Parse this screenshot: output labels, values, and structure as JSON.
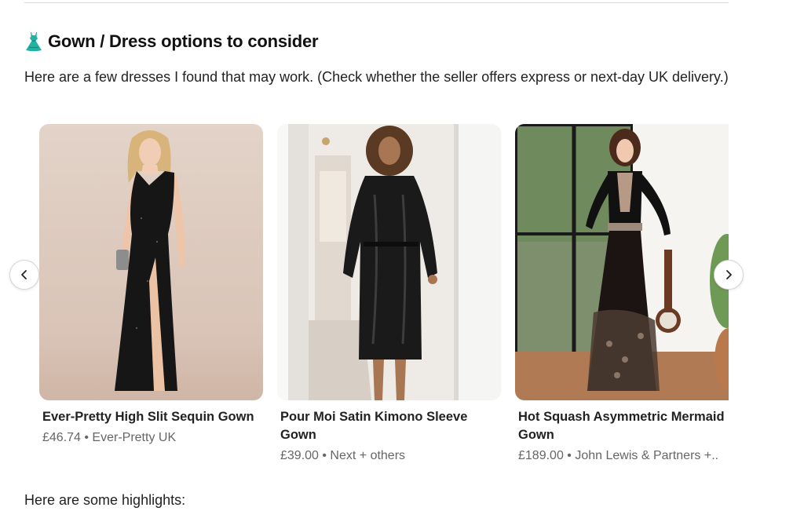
{
  "section": {
    "heading": "Gown / Dress options to consider",
    "heading_icon": "dress-icon",
    "intro": "Here are a few dresses I found that may work. (Check whether the seller offers express or next-day UK delivery.)"
  },
  "carousel": {
    "prev_icon": "chevron-left-icon",
    "next_icon": "chevron-right-icon",
    "products": [
      {
        "title": "Ever-Pretty High Slit Sequin Gown",
        "price": "£46.74",
        "seller": "Ever-Pretty UK",
        "meta": "£46.74 • Ever-Pretty UK"
      },
      {
        "title": "Pour Moi Satin Kimono Sleeve Gown",
        "price": "£39.00",
        "seller": "Next + others",
        "meta": "£39.00 • Next + others"
      },
      {
        "title": "Hot Squash Asymmetric Mermaid Gown",
        "price": "£189.00",
        "seller": "John Lewis & Partners +..",
        "meta": "£189.00 • John Lewis & Partners +.."
      }
    ]
  },
  "footer": {
    "highlights": "Here are some highlights:"
  },
  "colors": {
    "text": "#1f1f1f",
    "muted": "#666666",
    "divider": "#dcdcdc"
  }
}
